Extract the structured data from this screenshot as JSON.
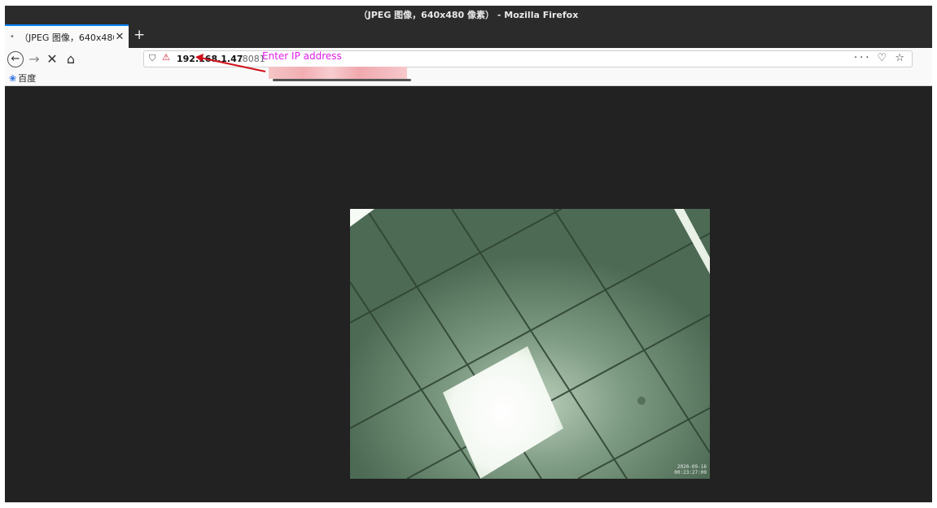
{
  "window": {
    "title": "（JPEG 图像，640x480 像素） - Mozilla Firefox"
  },
  "tab": {
    "title": "（JPEG 图像，640x480 像",
    "close_icon": "close-icon"
  },
  "toolbar": {
    "new_tab_glyph": "+",
    "back_glyph": "←",
    "forward_glyph": "→",
    "stop_glyph": "✕",
    "home_glyph": "⌂"
  },
  "urlbar": {
    "host": "192.168.1.47",
    "port": ":8081",
    "shield_glyph": "⛉",
    "insecure_glyph": "⚠",
    "page_actions_glyph": "···",
    "pocket_glyph": "♡",
    "star_glyph": "☆"
  },
  "bookmarks": [
    {
      "icon": "baidu-paw-icon",
      "label": "百度"
    }
  ],
  "annotation": {
    "text": "Enter IP address",
    "color": "#e01ce8"
  },
  "image": {
    "timestamp_line1": "2020-09-16",
    "timestamp_line2": "00:23:27:00"
  },
  "colors": {
    "page_background": "#222222",
    "accent_tab": "#0a84ff",
    "annotation": "#e01ce8",
    "arrow": "#d0101a"
  }
}
